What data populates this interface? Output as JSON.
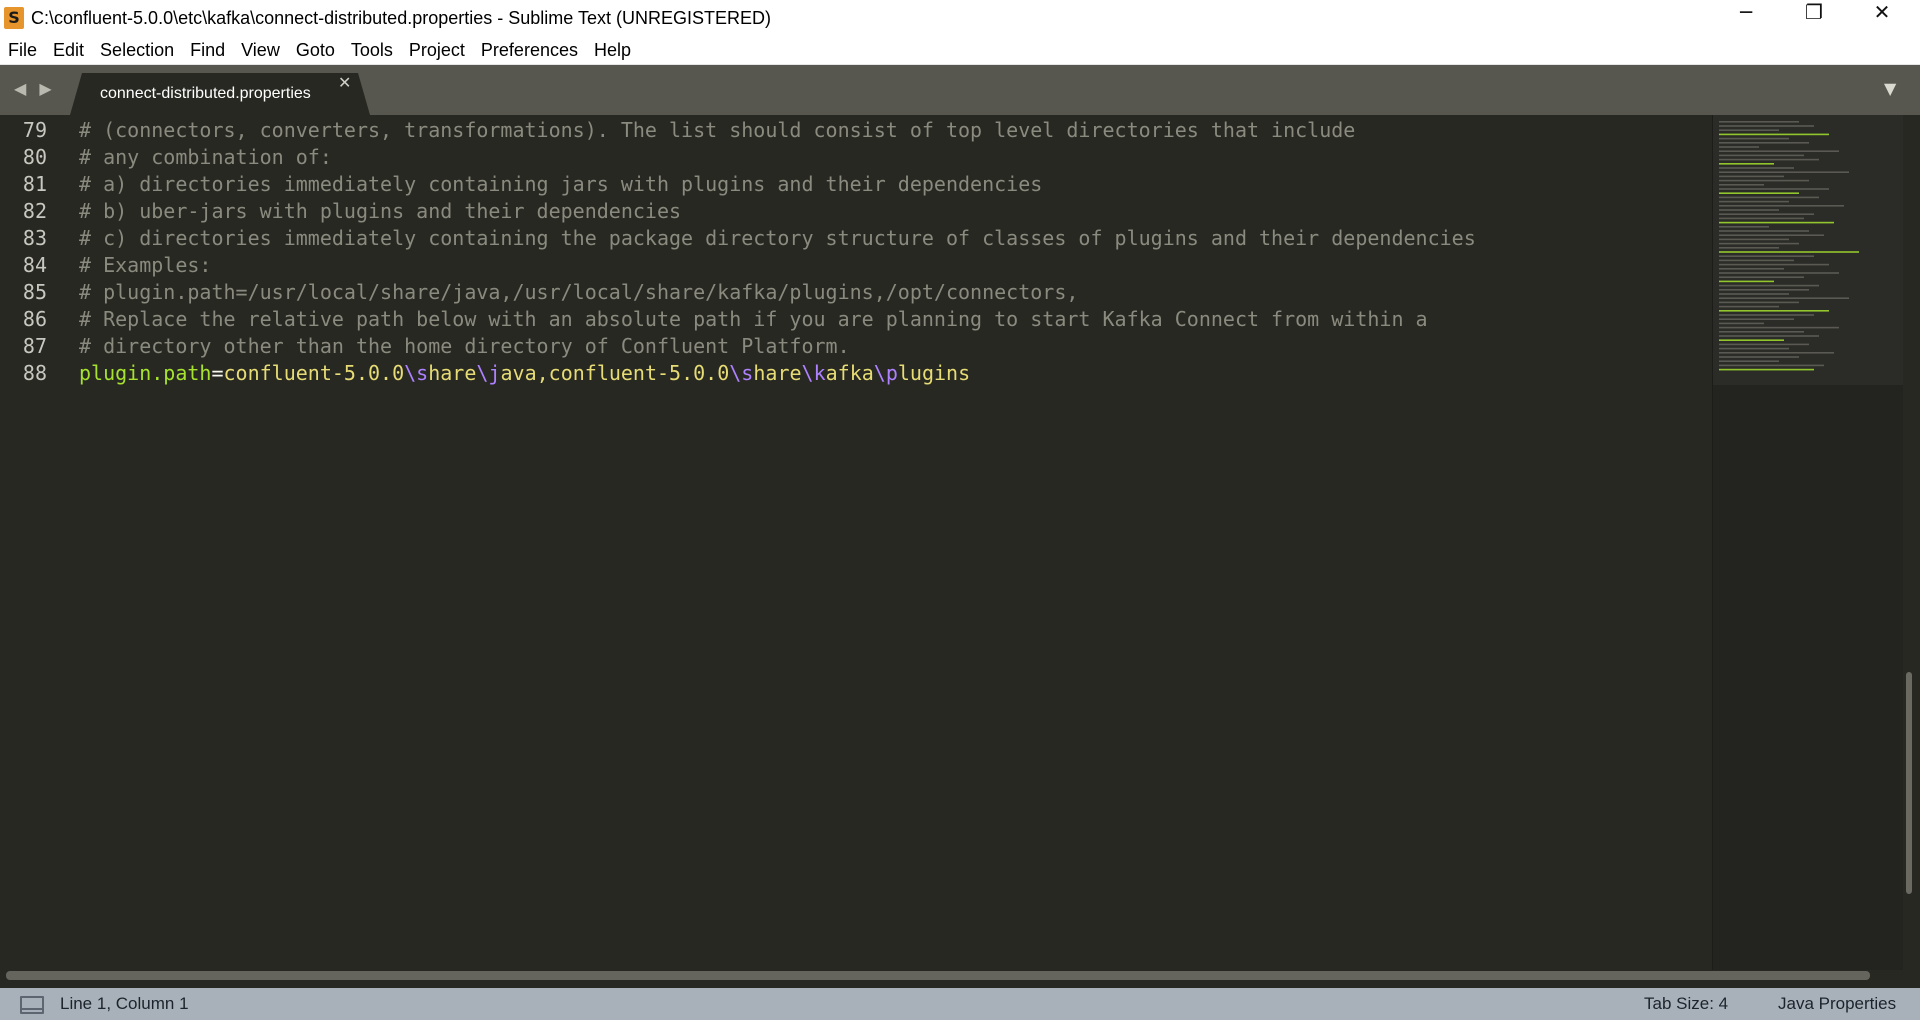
{
  "window": {
    "title": "C:\\confluent-5.0.0\\etc\\kafka\\connect-distributed.properties - Sublime Text (UNREGISTERED)",
    "controls": {
      "minimize": "─",
      "maximize": "❐",
      "close": "✕"
    }
  },
  "menu": [
    "File",
    "Edit",
    "Selection",
    "Find",
    "View",
    "Goto",
    "Tools",
    "Project",
    "Preferences",
    "Help"
  ],
  "tabs": {
    "nav_arrows": "◀ ▶",
    "active": {
      "label": "connect-distributed.properties",
      "close": "✕"
    },
    "dropdown": "▼"
  },
  "editor": {
    "lines": [
      {
        "number": "79",
        "text": "# (connectors, converters, transformations). The list should consist of top level directories that include"
      },
      {
        "number": "80",
        "text": "# any combination of:"
      },
      {
        "number": "81",
        "text": "# a) directories immediately containing jars with plugins and their dependencies"
      },
      {
        "number": "82",
        "text": "# b) uber-jars with plugins and their dependencies"
      },
      {
        "number": "83",
        "text": "# c) directories immediately containing the package directory structure of classes of plugins and their dependencies"
      },
      {
        "number": "84",
        "text": "# Examples:"
      },
      {
        "number": "85",
        "text": "# plugin.path=/usr/local/share/java,/usr/local/share/kafka/plugins,/opt/connectors,"
      },
      {
        "number": "86",
        "text": "# Replace the relative path below with an absolute path if you are planning to start Kafka Connect from within a"
      },
      {
        "number": "87",
        "text": "# directory other than the home directory of Confluent Platform."
      },
      {
        "number": "88",
        "key": "plugin.path",
        "eq": "=",
        "value_parts": [
          {
            "t": "confluent-5.0.0",
            "c": "val"
          },
          {
            "t": "\\s",
            "c": "esc"
          },
          {
            "t": "hare",
            "c": "val"
          },
          {
            "t": "\\j",
            "c": "esc"
          },
          {
            "t": "ava,confluent-5.0.0",
            "c": "val"
          },
          {
            "t": "\\s",
            "c": "esc"
          },
          {
            "t": "hare",
            "c": "val"
          },
          {
            "t": "\\k",
            "c": "esc"
          },
          {
            "t": "afka",
            "c": "val"
          },
          {
            "t": "\\p",
            "c": "esc"
          },
          {
            "t": "lugins",
            "c": "val"
          }
        ]
      }
    ]
  },
  "status": {
    "cursor": "Line 1, Column 1",
    "tab_size": "Tab Size: 4",
    "syntax": "Java Properties"
  },
  "colors": {
    "background": "#272822",
    "comment": "#8a8a7e",
    "key": "#a6e22e",
    "value": "#e6db74",
    "escape": "#ae81ff",
    "status_bar": "#a8b1ba",
    "tab_bar": "#57574f"
  }
}
